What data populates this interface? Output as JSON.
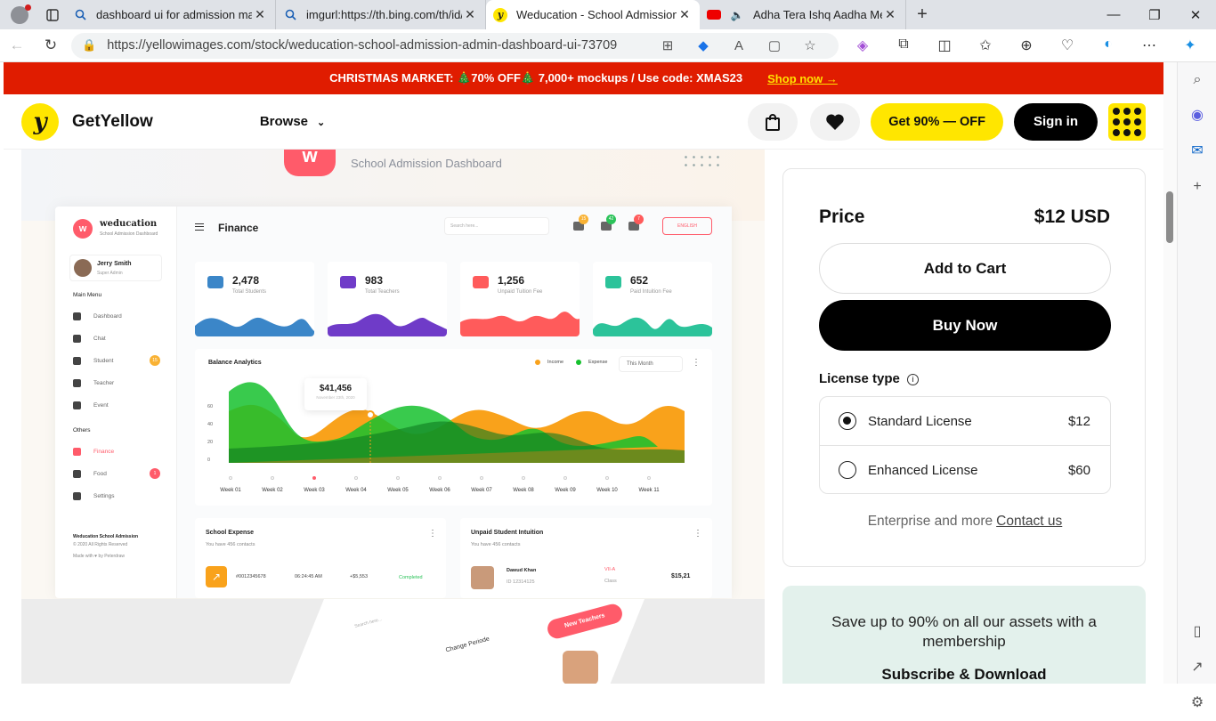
{
  "browser": {
    "tabs": [
      {
        "title": "dashboard ui for admission man",
        "icon": "search-icon"
      },
      {
        "title": "imgurl:https://th.bing.com/th/id/",
        "icon": "search-icon"
      },
      {
        "title": "Weducation - School Admission",
        "icon": "getyellow-favicon",
        "active": true
      },
      {
        "title": "Adha Tera Ishq Aadha Mera",
        "icon": "youtube-icon"
      }
    ],
    "url": "https://yellowimages.com/stock/weducation-school-admission-admin-dashboard-ui-73709"
  },
  "banner": {
    "text": "CHRISTMAS MARKET: 🎄70% OFF🎄 7,000+ mockups / Use code: XMAS23",
    "link": "Shop now →"
  },
  "header": {
    "brand": "GetYellow",
    "logo_letter": "y",
    "browse": "Browse",
    "offer_button": "Get 90% — OFF",
    "signin_button": "Sign in"
  },
  "preview": {
    "subtitle": "School Admission Dashboard",
    "logo_letter": "w",
    "app_name": "weducation",
    "app_tag": "School Admission Dashboard",
    "user": {
      "name": "Jerry Smith",
      "role": "Super Admin"
    },
    "main_menu_title": "Main Menu",
    "menu": [
      {
        "label": "Dashboard"
      },
      {
        "label": "Chat"
      },
      {
        "label": "Student",
        "badge": "15"
      },
      {
        "label": "Teacher"
      },
      {
        "label": "Event"
      }
    ],
    "others_title": "Others",
    "others": [
      {
        "label": "Finance",
        "active": true
      },
      {
        "label": "Food",
        "badge": "1"
      },
      {
        "label": "Settings"
      }
    ],
    "footer": {
      "name": "Weducation School Admission",
      "rights": "© 2020 All Rights Reserved",
      "made": "Made with ♥ by Peterdraw"
    },
    "page_title": "Finance",
    "search_placeholder": "Search here...",
    "notif_counts": [
      "15",
      "42",
      "7"
    ],
    "language": "ENGLISH",
    "stats": [
      {
        "value": "2,478",
        "label": "Total Students",
        "color": "#3b86c8"
      },
      {
        "value": "983",
        "label": "Total Teachers",
        "color": "#6f3bc8"
      },
      {
        "value": "1,256",
        "label": "Unpaid Tuition Fee",
        "color": "#ff5b5b"
      },
      {
        "value": "652",
        "label": "Paid Intuition Fee",
        "color": "#2cc39a"
      }
    ],
    "balance": {
      "title": "Balance Analytics",
      "legend_income": "Income",
      "legend_expense": "Expense",
      "period": "This Month",
      "tooltip_value": "$41,456",
      "tooltip_date": "November 23th, 2020",
      "y_ticks": [
        "60",
        "40",
        "20",
        "0"
      ],
      "weeks": [
        "Week 01",
        "Week 02",
        "Week 03",
        "Week 04",
        "Week 05",
        "Week 06",
        "Week 07",
        "Week 08",
        "Week 09",
        "Week 10",
        "Week 11"
      ]
    },
    "school_expense": {
      "title": "School Expense",
      "sub": "You have 456 contacts",
      "id": "#0012345678",
      "time": "06:24:45 AM",
      "amount": "+$5,553",
      "status": "Completed"
    },
    "unpaid": {
      "title": "Unpaid Student Intuition",
      "sub": "You have 456 contacts",
      "name": "Dawud Khan",
      "id": "ID 12314125",
      "class": "VII-A",
      "class_label": "Class",
      "amount": "$15,21"
    },
    "lower": {
      "search": "Search here...",
      "change_period": "Change Periode",
      "new_teachers": "New Teachers"
    }
  },
  "purchase": {
    "price_label": "Price",
    "price_value": "$12 USD",
    "add_to_cart": "Add to Cart",
    "buy_now": "Buy Now",
    "license_title": "License type",
    "licenses": [
      {
        "name": "Standard License",
        "price": "$12",
        "selected": true
      },
      {
        "name": "Enhanced License",
        "price": "$60",
        "selected": false
      }
    ],
    "enterprise_text": "Enterprise and more",
    "contact_link": "Contact us"
  },
  "membership": {
    "text": "Save up to 90% on all our assets with a membership",
    "cta": "Subscribe & Download"
  },
  "colors": {
    "banner": "#e01c00",
    "brand_yellow": "#ffe600",
    "accent_pink": "#ff5b6a",
    "income": "#f9a21b",
    "expense": "#16c12e"
  }
}
